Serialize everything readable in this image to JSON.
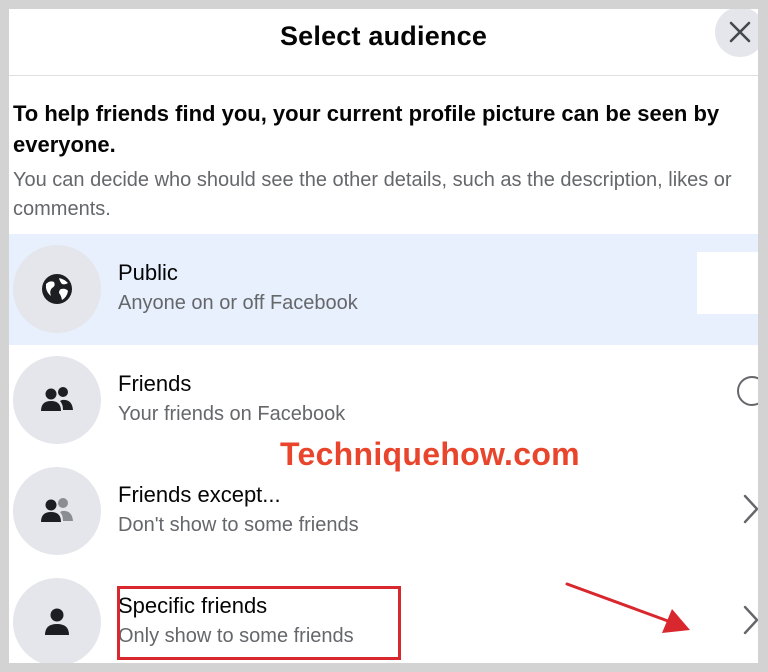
{
  "header": {
    "title": "Select audience",
    "close_icon": "close-icon"
  },
  "intro": {
    "bold": "To help friends find you, your current profile picture can be seen by everyone.",
    "sub": "You can decide who should see the other details, such as the description, likes or comments."
  },
  "options": [
    {
      "title": "Public",
      "subtitle": "Anyone on or off Facebook",
      "icon": "globe-icon",
      "selected": true,
      "control": "radio"
    },
    {
      "title": "Friends",
      "subtitle": "Your friends on Facebook",
      "icon": "friends-icon",
      "selected": false,
      "control": "radio"
    },
    {
      "title": "Friends except...",
      "subtitle": "Don't show to some friends",
      "icon": "friends-except-icon",
      "selected": false,
      "control": "chevron"
    },
    {
      "title": "Specific friends",
      "subtitle": "Only show to some friends",
      "icon": "person-icon",
      "selected": false,
      "control": "chevron"
    }
  ],
  "overlay": {
    "watermark": "Techniquehow.com"
  },
  "colors": {
    "selected_bg": "#e7f0fc",
    "watermark": "#e8452c",
    "annotation_red": "#d9272e"
  }
}
